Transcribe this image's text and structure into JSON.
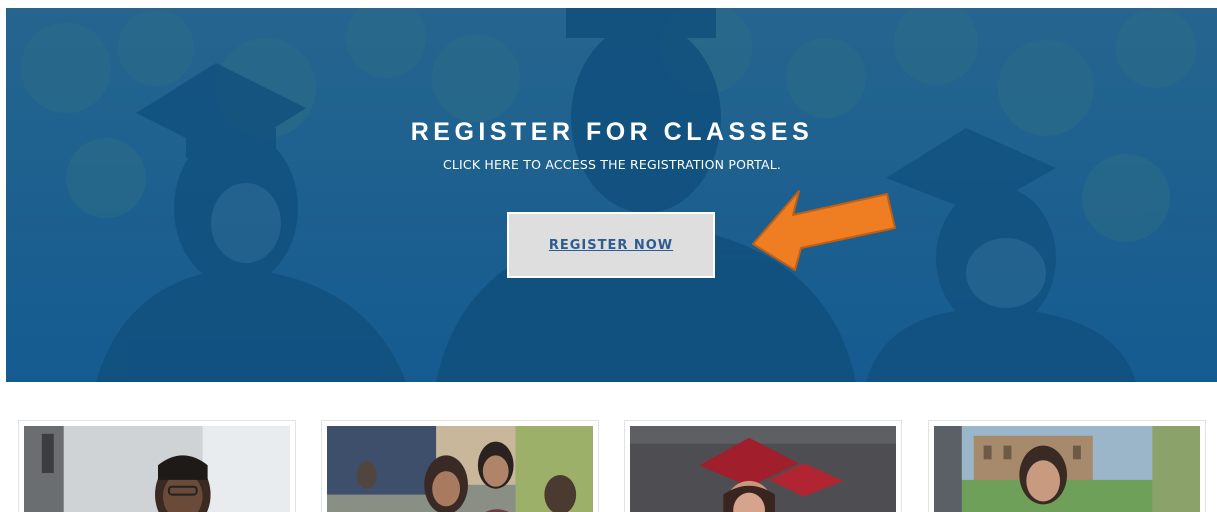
{
  "hero": {
    "title": "REGISTER FOR CLASSES",
    "subtitle": "CLICK HERE TO ACCESS THE REGISTRATION PORTAL.",
    "button_label": "REGISTER NOW",
    "background_image": "graduates-in-caps-and-gowns-photo",
    "overlay_color": "#105c96",
    "annotation": "orange-arrow-pointing-to-register-button",
    "annotation_color": "#ef7d22"
  },
  "cards": [
    {
      "image": "student-with-glasses-at-computer-photo"
    },
    {
      "image": "students-working-at-table-photo"
    },
    {
      "image": "graduates-in-red-caps-photo"
    },
    {
      "image": "student-outside-campus-building-photo"
    }
  ]
}
